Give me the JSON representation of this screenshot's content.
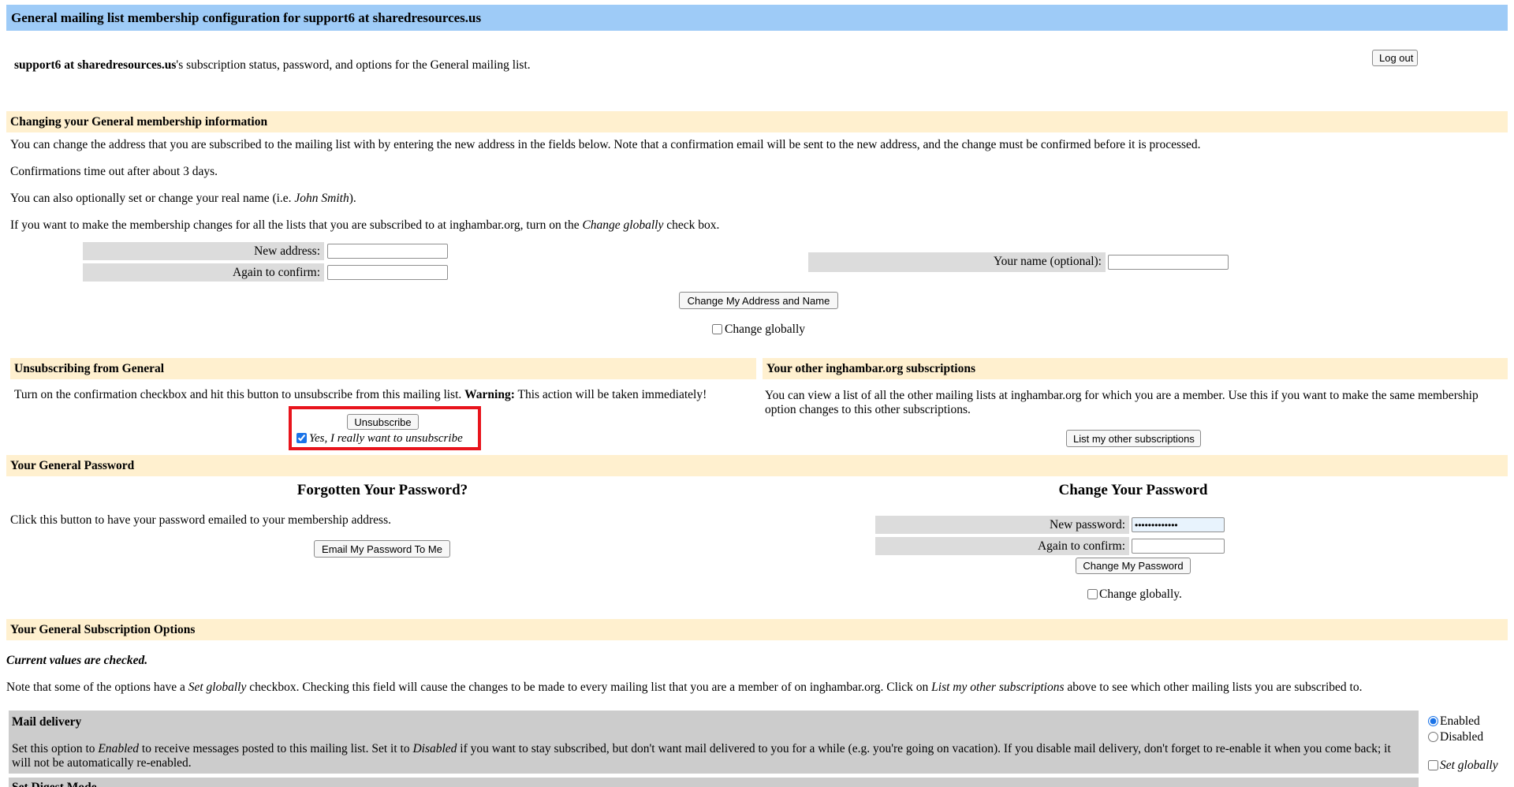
{
  "header": {
    "title": "General mailing list membership configuration for support6 at sharedresources.us"
  },
  "intro": {
    "user": "support6 at sharedresources.us",
    "text": "'s subscription status, password, and options for the General mailing list.",
    "logout_label": "Log out"
  },
  "membership": {
    "title": "Changing your General membership information",
    "p1": "You can change the address that you are subscribed to the mailing list with by entering the new address in the fields below. Note that a confirmation email will be sent to the new address, and the change must be confirmed before it is processed.",
    "p2": "Confirmations time out after about 3 days.",
    "p3_a": "You can also optionally set or change your real name (i.e. ",
    "p3_em": "John Smith",
    "p3_b": ").",
    "p4_a": "If you want to make the membership changes for all the lists that you are subscribed to at inghambar.org, turn on the ",
    "p4_em": "Change globally",
    "p4_b": " check box.",
    "new_address_label": "New address:",
    "new_address_value": "",
    "again_confirm_label": "Again to confirm:",
    "again_confirm_value": "",
    "your_name_label": "Your name (optional):",
    "your_name_value": "",
    "change_button": "Change My Address and Name",
    "change_globally_label": "Change globally"
  },
  "unsubscribe": {
    "title": "Unsubscribing from General",
    "text_a": "Turn on the confirmation checkbox and hit this button to unsubscribe from this mailing list. ",
    "text_warning": "Warning:",
    "text_b": " This action will be taken immediately!",
    "button": "Unsubscribe",
    "confirm_label": "Yes, I really want to unsubscribe",
    "confirm_checked": true
  },
  "other_subs": {
    "title": "Your other inghambar.org subscriptions",
    "text": "You can view a list of all the other mailing lists at inghambar.org for which you are a member. Use this if you want to make the same membership option changes to this other subscriptions.",
    "button": "List my other subscriptions"
  },
  "password": {
    "title": "Your General Password",
    "forgot_heading": "Forgotten Your Password?",
    "forgot_text": "Click this button to have your password emailed to your membership address.",
    "email_button": "Email My Password To Me",
    "change_heading": "Change Your Password",
    "new_password_label": "New password:",
    "new_password_value": "•••••••••••••",
    "again_confirm_label": "Again to confirm:",
    "again_confirm_value": "",
    "change_button": "Change My Password",
    "change_globally_label": "Change globally."
  },
  "options": {
    "title": "Your General Subscription Options",
    "current_values": "Current values are checked.",
    "note_a": "Note that some of the options have a ",
    "note_em1": "Set globally",
    "note_b": " checkbox. Checking this field will cause the changes to be made to every mailing list that you are a member of on inghambar.org. Click on ",
    "note_em2": "List my other subscriptions",
    "note_c": " above to see which other mailing lists you are subscribed to.",
    "mail_delivery": {
      "title": "Mail delivery",
      "desc_a": "Set this option to ",
      "desc_em1": "Enabled",
      "desc_b": " to receive messages posted to this mailing list. Set it to ",
      "desc_em2": "Disabled",
      "desc_c": " if you want to stay subscribed, but don't want mail delivered to you for a while (e.g. you're going on vacation). If you disable mail delivery, don't forget to re-enable it when you come back; it will not be automatically re-enabled.",
      "enabled_label": "Enabled",
      "disabled_label": "Disabled",
      "set_globally_label": "Set globally"
    },
    "next_title": "Set Digest Mode"
  }
}
